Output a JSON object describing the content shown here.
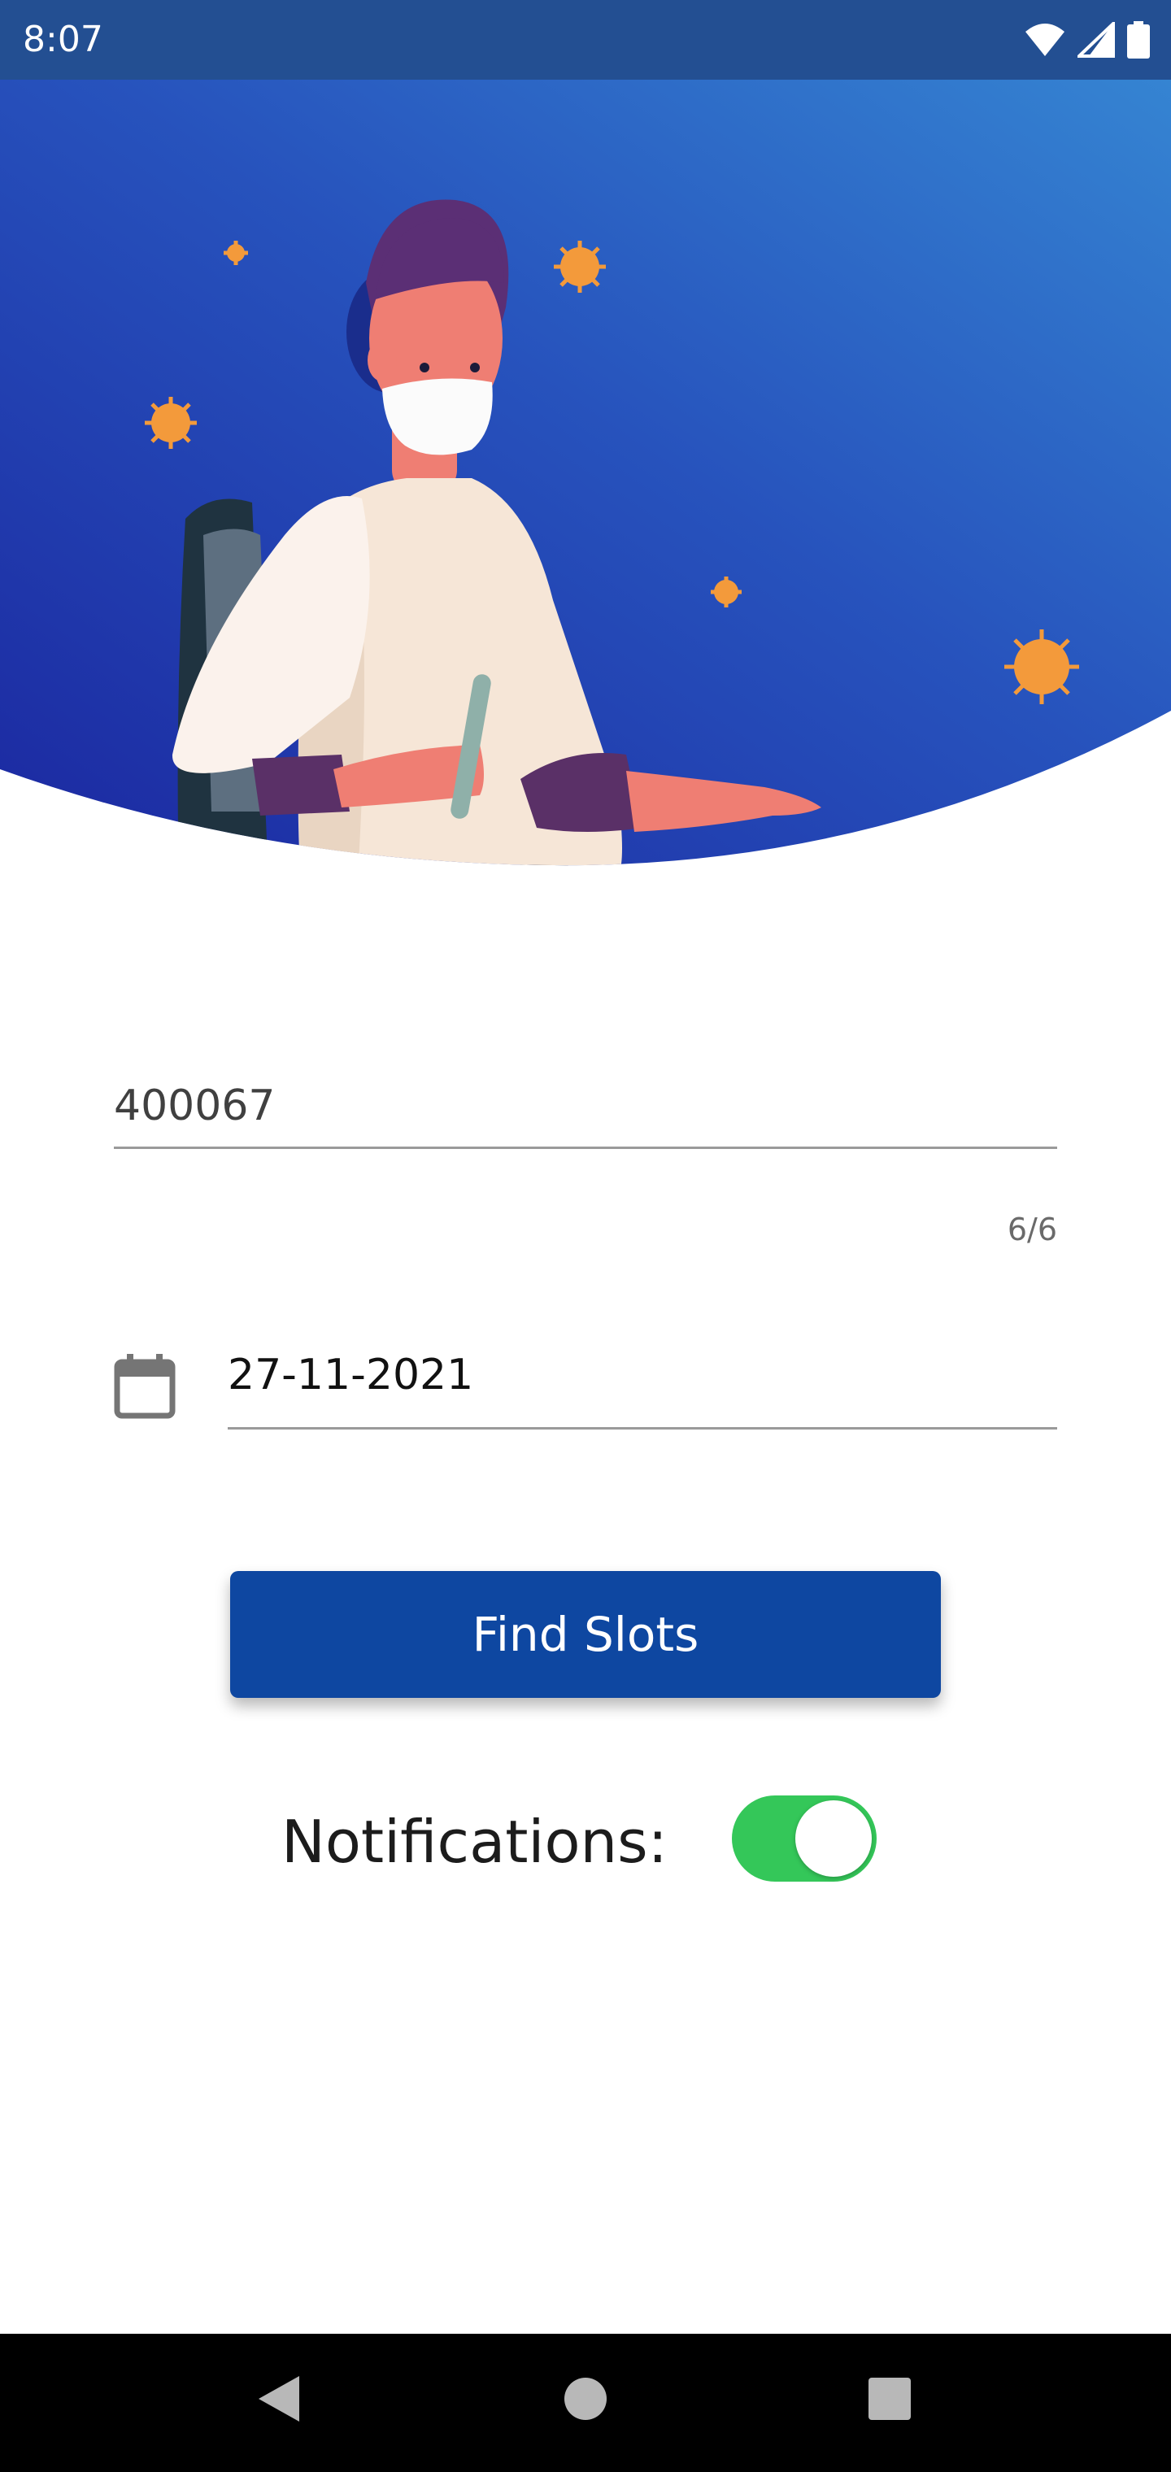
{
  "status_bar": {
    "time": "8:07",
    "icons": [
      "wifi-icon",
      "cell-signal-icon",
      "battery-icon"
    ]
  },
  "hero": {
    "illustration": "masked-doctor-with-test-tube",
    "gradient": [
      "#1f2fa6",
      "#3a86d2"
    ]
  },
  "form": {
    "pincode": {
      "value": "400067",
      "counter": "6/6"
    },
    "date": {
      "icon": "calendar-icon",
      "value": "27-11-2021"
    },
    "find_button_label": "Find Slots",
    "notifications": {
      "label": "Notifications:",
      "enabled": true
    }
  },
  "colors": {
    "primary_button": "#0e47a1",
    "toggle_on": "#34c759",
    "status_bar": "#234f92"
  },
  "nav_bar": {
    "buttons": [
      "back-icon",
      "home-icon",
      "recents-icon"
    ]
  }
}
